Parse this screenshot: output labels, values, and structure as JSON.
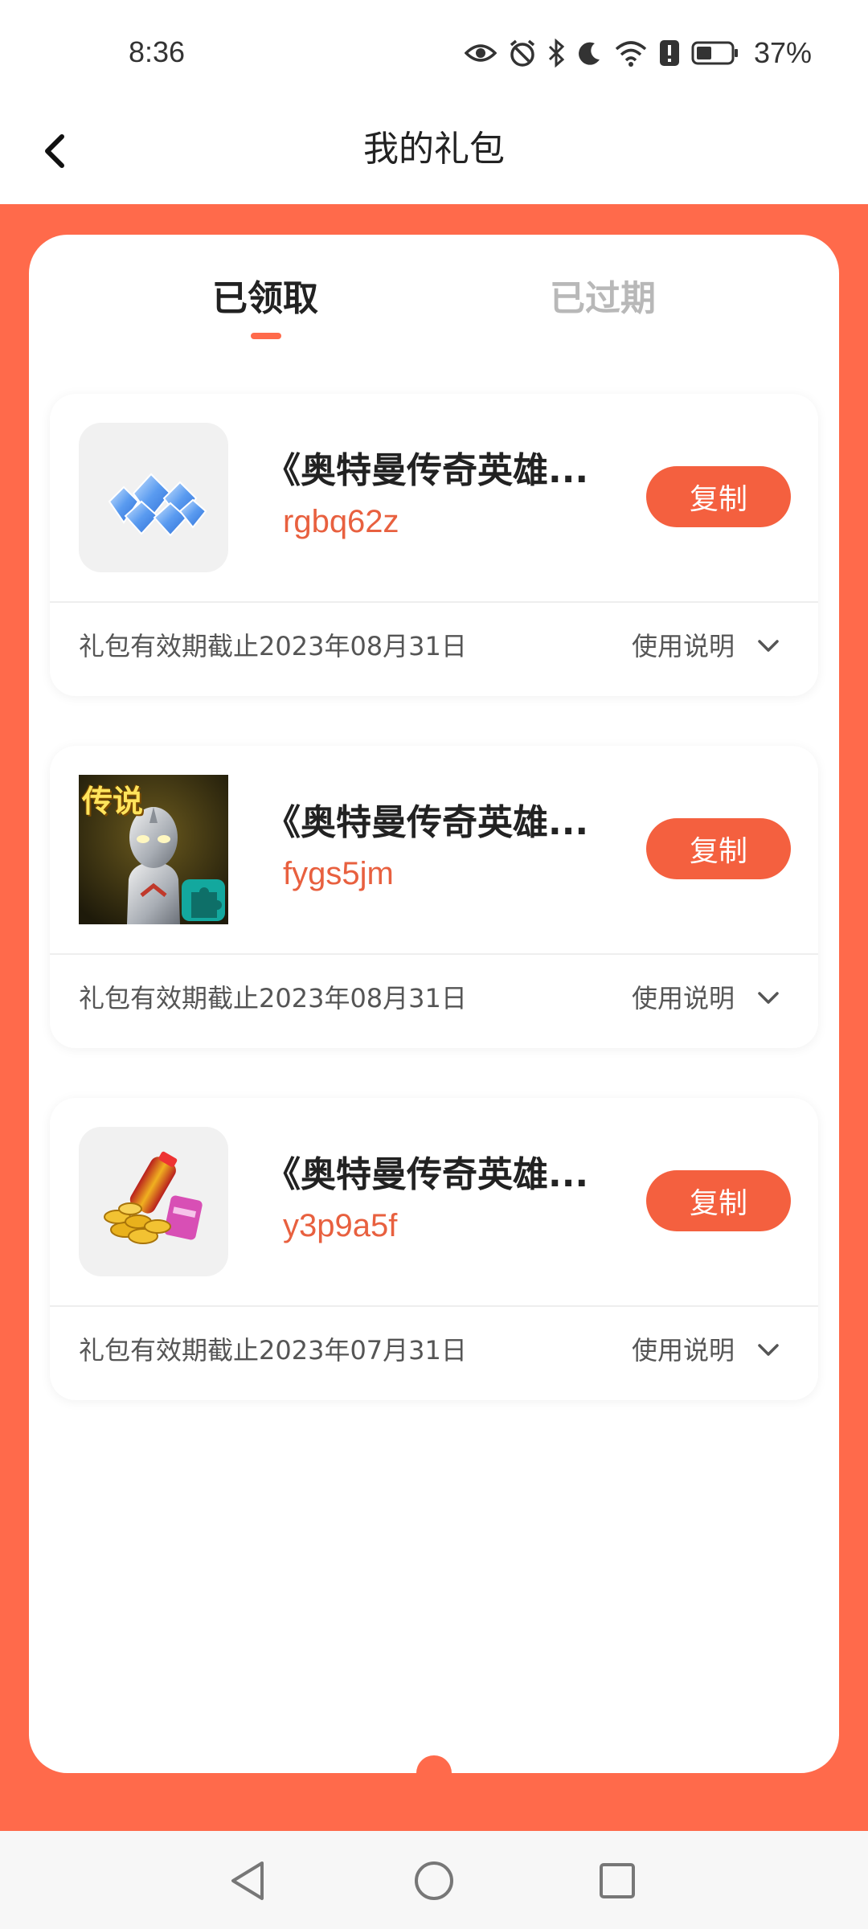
{
  "status_bar": {
    "time": "8:36",
    "battery_percent": "37%",
    "icons": [
      "eye-icon",
      "alarm-icon",
      "bluetooth-icon",
      "moon-icon",
      "wifi-icon",
      "alert-icon",
      "battery-icon"
    ]
  },
  "header": {
    "title": "我的礼包",
    "back_icon": "chevron-left-icon"
  },
  "tabs": [
    {
      "label": "已领取",
      "active": true
    },
    {
      "label": "已过期",
      "active": false
    }
  ],
  "colors": {
    "accent": "#FF6A4B",
    "button": "#F4603F",
    "code_text": "#E8603F"
  },
  "gifts": [
    {
      "name": "《奥特曼传奇英雄...",
      "code": "rgbq62z",
      "copy_label": "复制",
      "expiry": "礼包有效期截止2023年08月31日",
      "usage_label": "使用说明",
      "thumb_icon": "diamond-pile-icon"
    },
    {
      "name": "《奥特曼传奇英雄...",
      "code": "fygs5jm",
      "copy_label": "复制",
      "expiry": "礼包有效期截止2023年08月31日",
      "usage_label": "使用说明",
      "thumb_icon": "ultraman-legend-icon",
      "thumb_badge": "传说"
    },
    {
      "name": "《奥特曼传奇英雄...",
      "code": "y3p9a5f",
      "copy_label": "复制",
      "expiry": "礼包有效期截止2023年07月31日",
      "usage_label": "使用说明",
      "thumb_icon": "gold-coins-icon"
    }
  ],
  "navbar": {
    "icons": [
      "back-triangle-icon",
      "home-circle-icon",
      "recents-square-icon"
    ]
  }
}
